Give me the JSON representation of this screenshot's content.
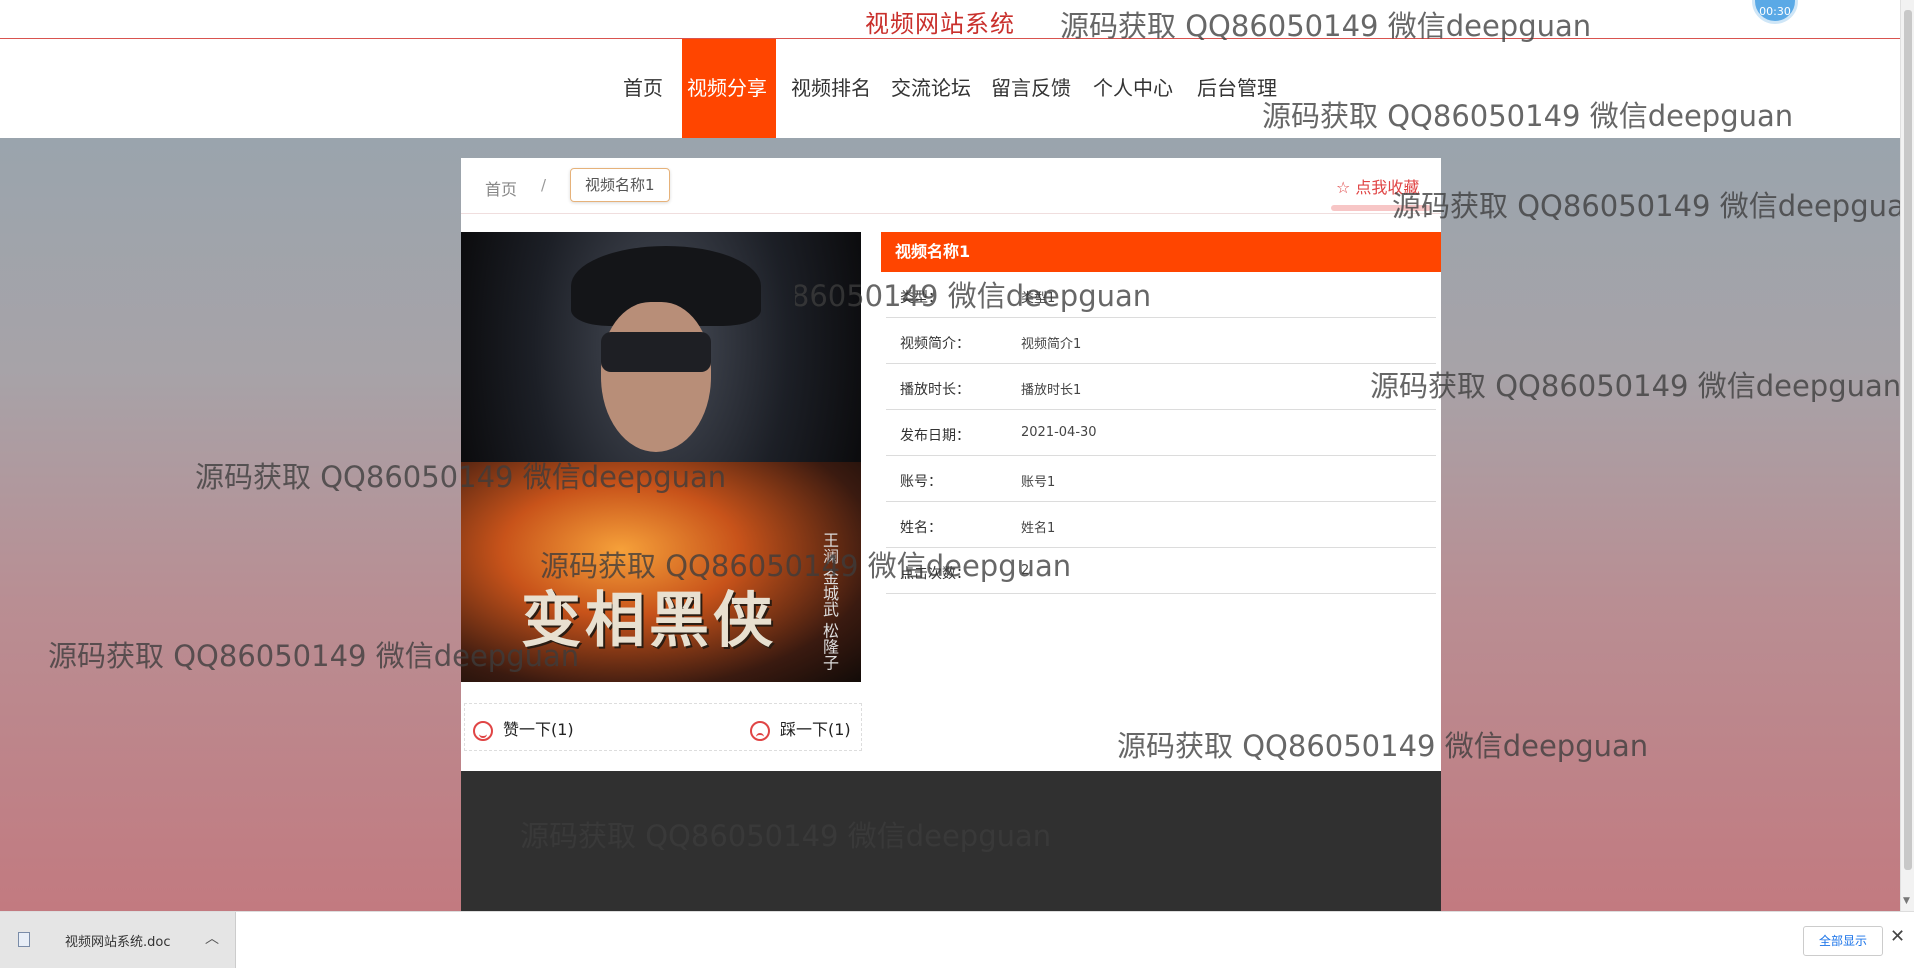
{
  "header": {
    "site_title": "视频网站系统",
    "timer_text": "00:30"
  },
  "nav": {
    "items": [
      {
        "label": "首页"
      },
      {
        "label": "视频分享",
        "active": true
      },
      {
        "label": "视频排名"
      },
      {
        "label": "交流论坛"
      },
      {
        "label": "留言反馈"
      },
      {
        "label": "个人中心"
      },
      {
        "label": "后台管理"
      }
    ]
  },
  "breadcrumb": {
    "home": "首页",
    "separator": "/",
    "current": "视频名称1"
  },
  "favorite": {
    "label": "☆ 点我收藏"
  },
  "poster": {
    "title": "变相黑侠",
    "credits": "王澜 金城武 松隆子"
  },
  "votes": {
    "like": "赞一下(1)",
    "dislike": "踩一下(1)"
  },
  "detail": {
    "header": "视频名称1",
    "rows": [
      {
        "label": "类型：",
        "value": "类型1"
      },
      {
        "label": "视频简介：",
        "value": "视频简介1"
      },
      {
        "label": "播放时长：",
        "value": "播放时长1"
      },
      {
        "label": "发布日期：",
        "value": "2021-04-30"
      },
      {
        "label": "账号：",
        "value": "账号1"
      },
      {
        "label": "姓名：",
        "value": "姓名1"
      },
      {
        "label": "点击次数：",
        "value": "2"
      }
    ]
  },
  "watermark": {
    "text": "源码获取 QQ86050149 微信deepguan"
  },
  "download_bar": {
    "file_name": "视频网站系统.doc",
    "show_all": "全部显示",
    "close": "✕"
  },
  "colors": {
    "accent": "#ff4500",
    "title_red": "#c9302c",
    "footer": "#303030"
  }
}
